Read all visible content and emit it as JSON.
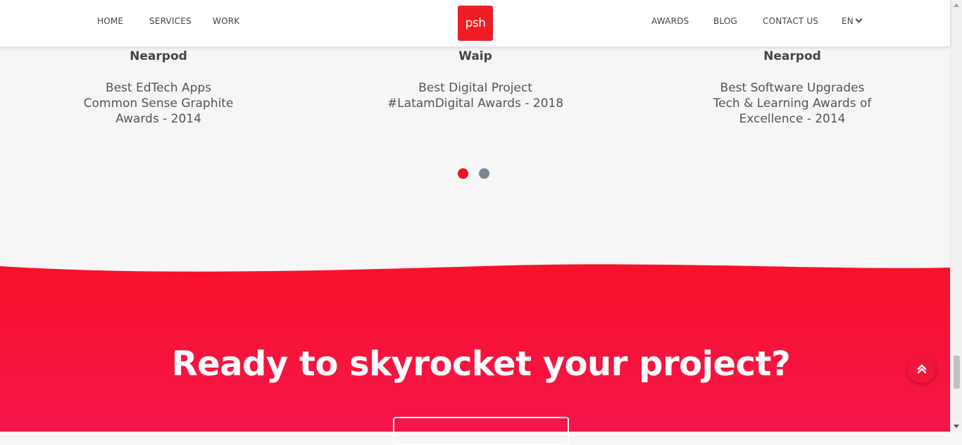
{
  "nav": {
    "left": [
      {
        "label": "HOME"
      },
      {
        "label": "SERVICES"
      },
      {
        "label": "WORK"
      }
    ],
    "logo_text": "psh",
    "right": [
      {
        "label": "AWARDS"
      },
      {
        "label": "BLOG"
      },
      {
        "label": "CONTACT US"
      }
    ],
    "language": "EN"
  },
  "awards": [
    {
      "name": "Nearpod",
      "lines": [
        "Best EdTech Apps",
        "Common Sense Graphite",
        "Awards - 2014"
      ]
    },
    {
      "name": "Waip",
      "lines": [
        "Best Digital Project",
        "#LatamDigital Awards - 2018"
      ]
    },
    {
      "name": "Nearpod",
      "lines": [
        "Best Software Upgrades",
        "Tech & Learning Awards of",
        "Excellence - 2014"
      ]
    }
  ],
  "carousel": {
    "total_slides": 2,
    "active_slide": 1
  },
  "cta": {
    "title": "Ready to skyrocket your project?"
  },
  "colors": {
    "brand_red": "#ee1c25",
    "cta_top": "#f8112a",
    "cta_bottom": "#f6154a",
    "dot_active": "#ee0f23",
    "dot_inactive": "#7d8590"
  },
  "icons": {
    "back_to_top": "double-chevron-up-icon",
    "language_dropdown": "chevron-down-icon"
  }
}
